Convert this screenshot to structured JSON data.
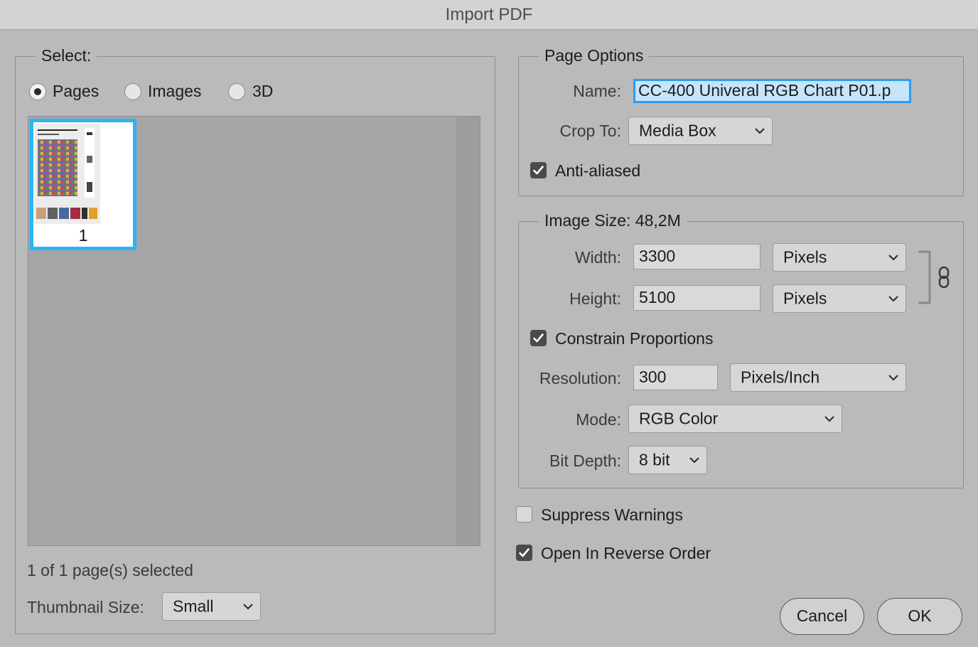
{
  "window": {
    "title": "Import PDF"
  },
  "select_group": {
    "legend": "Select:",
    "options": [
      {
        "label": "Pages",
        "selected": true
      },
      {
        "label": "Images",
        "selected": false
      },
      {
        "label": "3D",
        "selected": false
      }
    ],
    "thumbnail_page_number": "1",
    "selection_status": "1 of 1 page(s) selected",
    "thumbnail_size_label": "Thumbnail Size:",
    "thumbnail_size_value": "Small"
  },
  "page_options": {
    "legend": "Page Options",
    "name_label": "Name:",
    "name_value": "CC-400 Univeral RGB Chart P01.p",
    "crop_label": "Crop To:",
    "crop_value": "Media Box",
    "anti_aliased_label": "Anti-aliased",
    "anti_aliased_checked": true
  },
  "image_size": {
    "legend": "Image Size: 48,2M",
    "width_label": "Width:",
    "width_value": "3300",
    "width_unit": "Pixels",
    "height_label": "Height:",
    "height_value": "5100",
    "height_unit": "Pixels",
    "constrain_label": "Constrain Proportions",
    "constrain_checked": true,
    "resolution_label": "Resolution:",
    "resolution_value": "300",
    "resolution_unit": "Pixels/Inch",
    "mode_label": "Mode:",
    "mode_value": "RGB Color",
    "bit_depth_label": "Bit Depth:",
    "bit_depth_value": "8 bit"
  },
  "options": {
    "suppress_warnings_label": "Suppress Warnings",
    "suppress_warnings_checked": false,
    "reverse_order_label": "Open In Reverse Order",
    "reverse_order_checked": true
  },
  "buttons": {
    "cancel": "Cancel",
    "ok": "OK"
  },
  "colors": {
    "dialog_bg": "#bababa",
    "focus_ring": "#2a9ef0",
    "thumb_selection": "#29b5f5"
  }
}
